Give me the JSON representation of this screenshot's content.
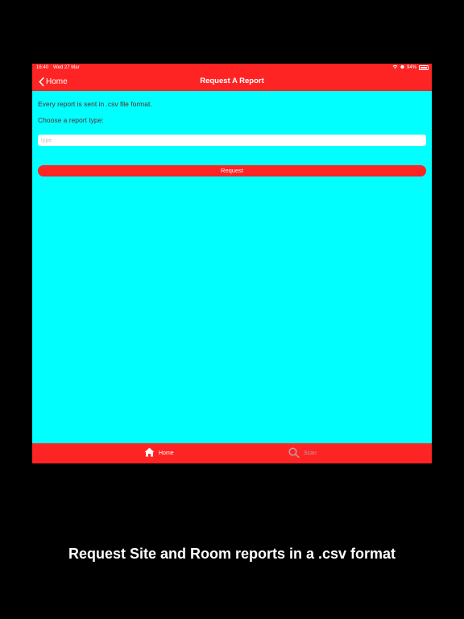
{
  "status_bar": {
    "time": "16:40",
    "date": "Wed 27 Mar",
    "battery": "94%"
  },
  "nav": {
    "back_label": "Home",
    "title": "Request A Report"
  },
  "content": {
    "info": "Every report is sent in .csv file format.",
    "prompt": "Choose a report type:",
    "type_input": {
      "value": "",
      "placeholder": "type"
    },
    "request_label": "Request"
  },
  "tabs": [
    {
      "label": "Home",
      "icon": "home-icon",
      "active": true
    },
    {
      "label": "Scan",
      "icon": "search-icon",
      "active": false
    }
  ],
  "caption": "Request Site and Room reports in a .csv format",
  "colors": {
    "accent": "#FF2424",
    "background": "#00FFFF",
    "frame": "#000000"
  }
}
